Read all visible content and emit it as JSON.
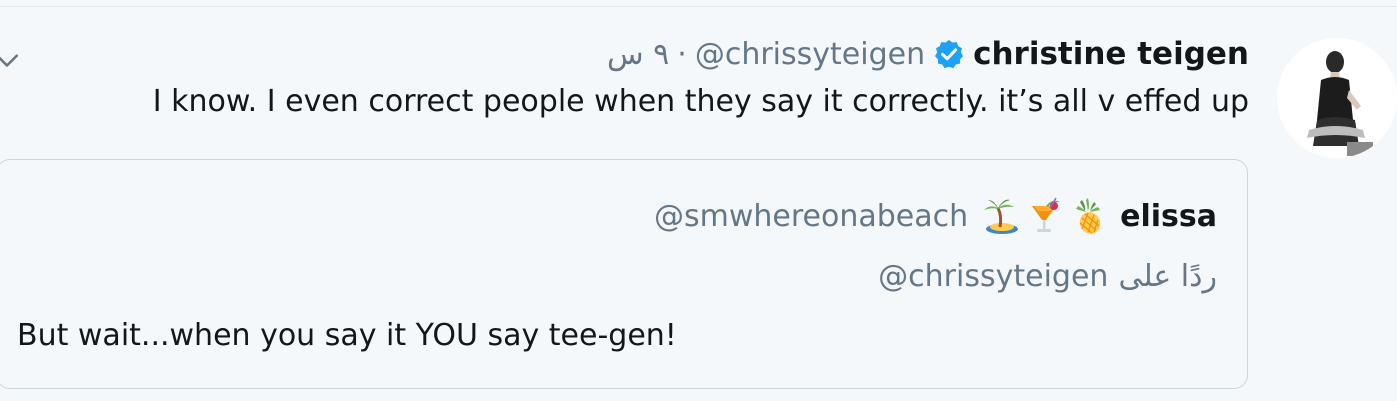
{
  "tweet": {
    "author_name": "christine teigen",
    "author_handle": "@chrissyteigen",
    "separator": "·",
    "timestamp": "٩ س",
    "verified": true,
    "text": "I know. I even correct people when they say it correctly. it’s all v effed up",
    "icons": {
      "menu": "chevron-down-icon",
      "verified": "verified-badge-icon",
      "avatar": "avatar"
    }
  },
  "quoted_tweet": {
    "author_name": "elissa",
    "name_emojis": [
      "pineapple-icon",
      "tropical-drink-icon",
      "desert-island-icon"
    ],
    "author_handle": "@smwhereonabeach",
    "reply_label": "ردًا على",
    "reply_mention": "@chrissyteigen",
    "text": "But wait...when you say it YOU say tee-gen!"
  },
  "colors": {
    "background": "#f5f8fa",
    "primary_text": "#14171a",
    "secondary_text": "#657786",
    "verified_blue": "#1da1f2",
    "border": "#ccd6dd"
  }
}
